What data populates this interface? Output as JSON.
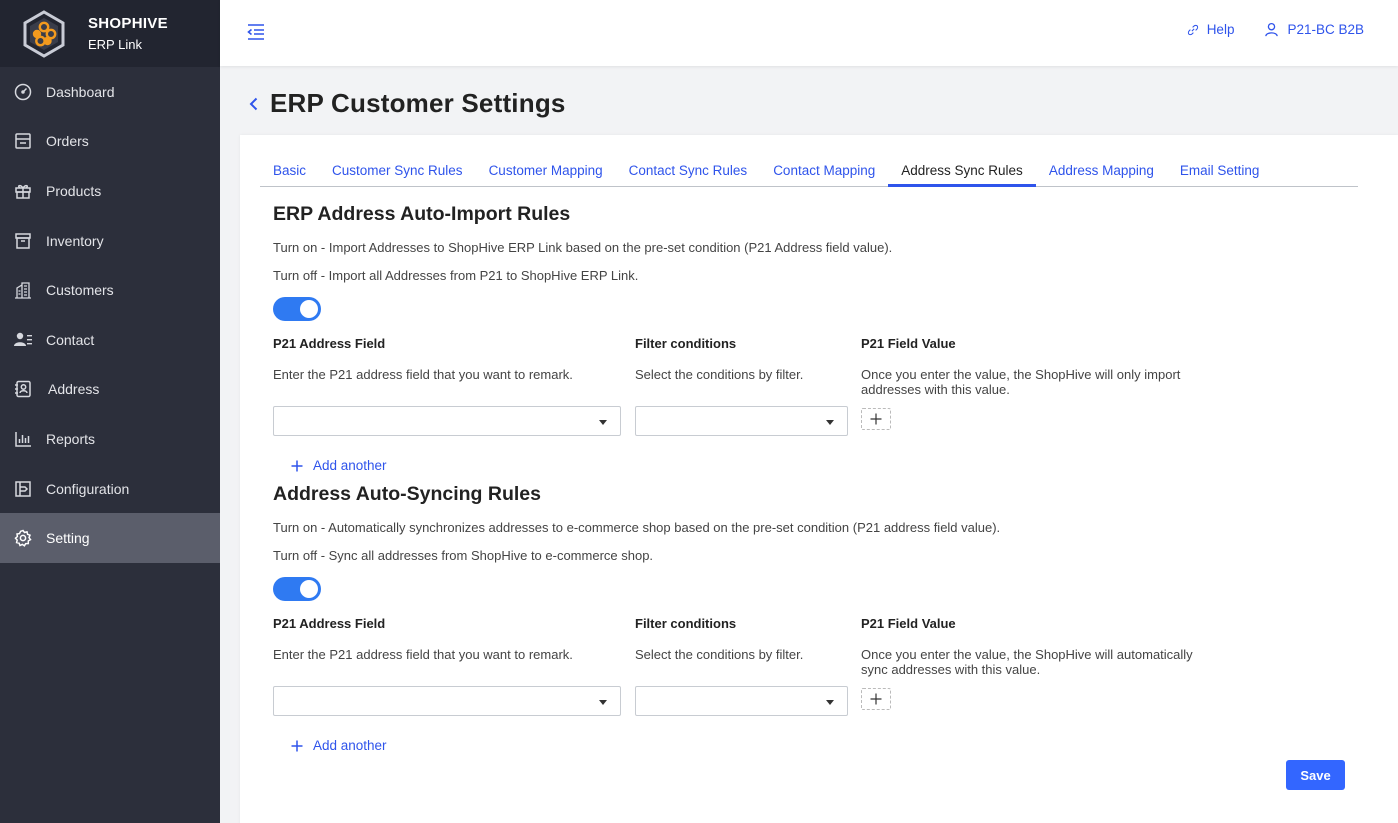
{
  "brand": {
    "name": "SHOPHIVE",
    "sub": "ERP Link"
  },
  "sidebar": {
    "items": [
      {
        "label": "Dashboard",
        "icon": "dashboard-icon"
      },
      {
        "label": "Orders",
        "icon": "orders-icon"
      },
      {
        "label": "Products",
        "icon": "gift-icon"
      },
      {
        "label": "Inventory",
        "icon": "inventory-icon"
      },
      {
        "label": "Customers",
        "icon": "building-icon"
      },
      {
        "label": "Contact",
        "icon": "contact-icon"
      },
      {
        "label": "Address",
        "icon": "address-book-icon"
      },
      {
        "label": "Reports",
        "icon": "bar-chart-icon"
      },
      {
        "label": "Configuration",
        "icon": "configuration-icon"
      },
      {
        "label": "Setting",
        "icon": "gear-icon",
        "active": true
      }
    ]
  },
  "header": {
    "help": "Help",
    "user": "P21-BC B2B"
  },
  "page": {
    "title": "ERP Customer Settings"
  },
  "tabs": [
    "Basic",
    "Customer Sync Rules",
    "Customer Mapping",
    "Contact Sync Rules",
    "Contact Mapping",
    "Address Sync Rules",
    "Address Mapping",
    "Email Setting"
  ],
  "active_tab": "Address Sync Rules",
  "import_rules": {
    "title": "ERP Address Auto-Import Rules",
    "turn_on": "Turn on - Import Addresses to ShopHive ERP Link based on the pre-set condition (P21 Address field value).",
    "turn_off": "Turn off - Import all Addresses from P21 to ShopHive ERP Link.",
    "toggle_on": true,
    "col_field": "P21 Address Field",
    "col_filter": "Filter conditions",
    "col_value": "P21 Field Value",
    "desc_field": "Enter the P21 address field that you want to remark.",
    "desc_filter": "Select the conditions by filter.",
    "desc_value": "Once you enter the value, the ShopHive will only import addresses with this value.",
    "add_another": "Add another"
  },
  "sync_rules": {
    "title": "Address Auto-Syncing Rules",
    "turn_on": "Turn on - Automatically synchronizes addresses to e-commerce shop based on the pre-set condition (P21 address field value).",
    "turn_off": "Turn off - Sync all addresses from ShopHive to e-commerce shop.",
    "toggle_on": true,
    "col_field": "P21 Address Field",
    "col_filter": "Filter conditions",
    "col_value": "P21 Field Value",
    "desc_field": "Enter the P21 address field that you want to remark.",
    "desc_filter": "Select the conditions by filter.",
    "desc_value": "Once you enter the value, the ShopHive will automatically sync addresses with this value.",
    "add_another": "Add another"
  },
  "save_label": "Save",
  "colors": {
    "accent": "#2f54eb",
    "toggle": "#2f7af2",
    "sidebar": "#2c2f3b",
    "save": "#3366ff"
  }
}
